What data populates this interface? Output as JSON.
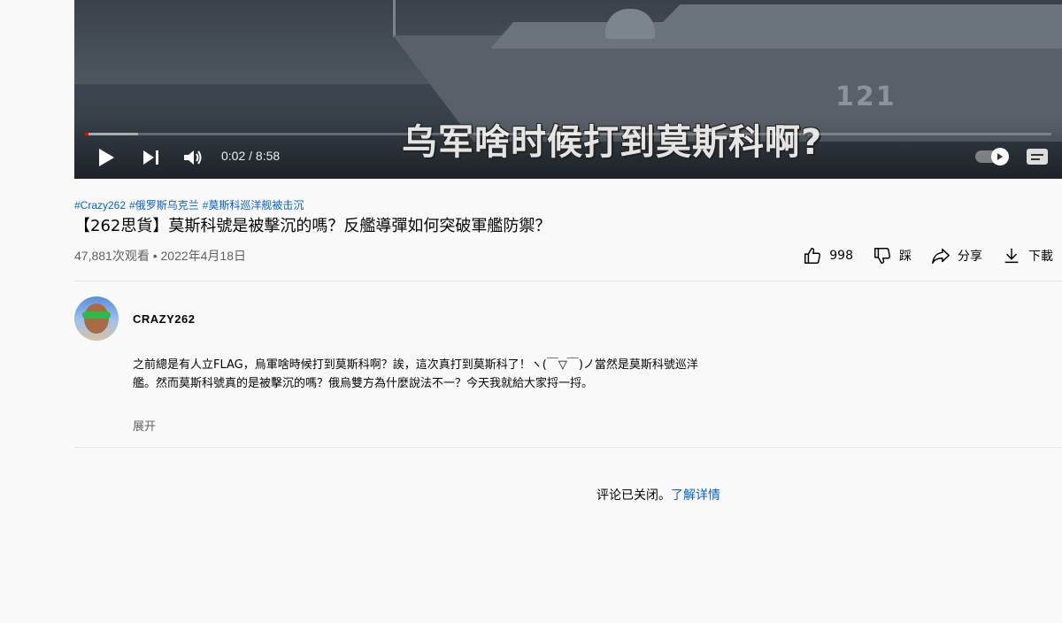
{
  "player": {
    "subtitle_text": "乌军啥时候打到莫斯科啊?",
    "hull_number": "121",
    "current_time": "0:02",
    "duration": "8:58",
    "time_display": "0:02 / 8:58",
    "progress_played": 0.004,
    "progress_buffered": 0.055,
    "autoplay_on": true,
    "icons": [
      "play-icon",
      "next-icon",
      "volume-icon",
      "autoplay-toggle",
      "subtitles-icon"
    ]
  },
  "video": {
    "hashtags": [
      "#Crazy262",
      "#俄罗斯乌克兰",
      "#莫斯科巡洋舰被击沉"
    ],
    "title": "【262思貨】莫斯科號是被擊沉的嗎？反艦導彈如何突破軍艦防禦？",
    "views_line": "47,881次观看 • 2022年4月18日"
  },
  "actions": {
    "like_count": "998",
    "dislike_label": "踩",
    "share_label": "分享",
    "download_label": "下載"
  },
  "channel": {
    "name": "CRAZY262"
  },
  "description": {
    "text": "之前總是有人立FLAG，烏軍啥時候打到莫斯科啊？誒，這次真打到莫斯科了！ヽ(￣▽￣)ノ當然是莫斯科號巡洋艦。然而莫斯科號真的是被擊沉的嗎？俄烏雙方為什麼說法不一？今天我就給大家捋一捋。",
    "show_more": "展开"
  },
  "comments": {
    "closed_text": "评论已关闭。",
    "learn_more": "了解详情"
  },
  "colors": {
    "link": "#065fd4",
    "progress": "#ff0000",
    "secondary_text": "#606060"
  }
}
